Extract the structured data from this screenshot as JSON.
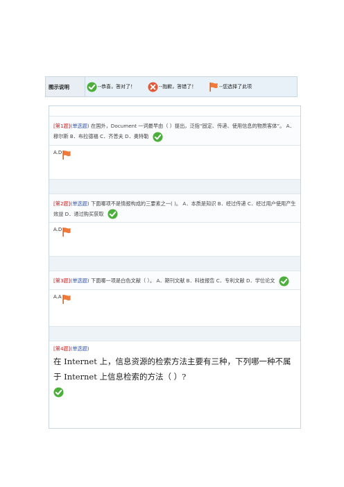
{
  "legend": {
    "title": "图示说明",
    "correct": "--恭喜，答对了！",
    "wrong": "--抱歉，答错了！",
    "chosen": "--您选择了此项"
  },
  "questions": [
    {
      "num": "[第1题]",
      "type": "(单选题)",
      "text": "在国外，Document 一词最早由（ ）提出，泛指“固定、传递、使用信息的物质客体”。 A．穆尔斯 B．布拉德福 C．齐普夫 D．奥特勒",
      "answer": "A.D"
    },
    {
      "num": "[第2题]",
      "type": "(单选题)",
      "text": "下面哪项不是情报构成的三要素之一( )。 A．本质是知识 B．经过传递 C．经过用户使用产生效益 D．通过购买获取",
      "answer": "A.D"
    },
    {
      "num": "[第3题]",
      "type": "(单选题)",
      "text": "下面哪一项是白色文献（ ）。 A．期刊文献    B．科技报告    C．专利文献    D．学位论文",
      "answer": "A.A"
    },
    {
      "num": "[第4题]",
      "type": "(单选题)",
      "text": "在 Internet 上，信息资源的检索方法主要有三种，下列哪一种不属于 Internet 上信息检索的方法（   ）?"
    }
  ],
  "icons": {
    "correct": "check-circle-icon",
    "wrong": "x-circle-icon",
    "chosen": "flag-icon"
  },
  "colors": {
    "correct": "#4caf3c",
    "wrong": "#e05a3a",
    "flag": "#f07a3a",
    "question_number": "#cc2222",
    "question_type": "#3355aa"
  }
}
